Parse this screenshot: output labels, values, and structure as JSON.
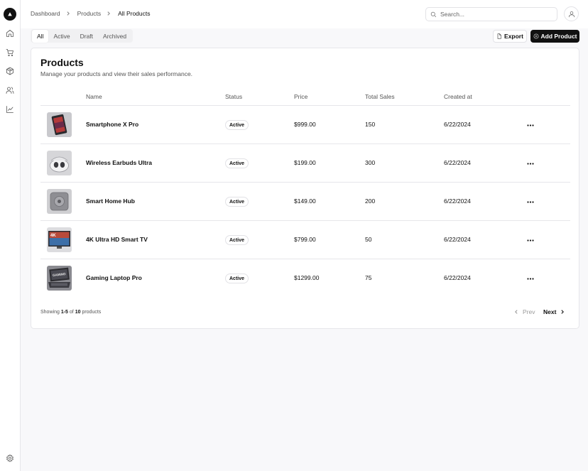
{
  "sidebar": {
    "items": [
      {
        "icon": "home-icon",
        "label": "Dashboard"
      },
      {
        "icon": "cart-icon",
        "label": "Orders"
      },
      {
        "icon": "package-icon",
        "label": "Products"
      },
      {
        "icon": "users-icon",
        "label": "Customers"
      },
      {
        "icon": "chart-icon",
        "label": "Analytics"
      }
    ],
    "settings_icon": "gear-icon"
  },
  "breadcrumb": {
    "items": [
      "Dashboard",
      "Products",
      "All Products"
    ]
  },
  "search": {
    "placeholder": "Search...",
    "value": ""
  },
  "tabs": [
    {
      "label": "All",
      "active": true
    },
    {
      "label": "Active",
      "active": false
    },
    {
      "label": "Draft",
      "active": false
    },
    {
      "label": "Archived",
      "active": false
    }
  ],
  "toolbar": {
    "export_label": "Export",
    "add_label": "Add Product"
  },
  "card": {
    "title": "Products",
    "subtitle": "Manage your products and view their sales performance."
  },
  "table": {
    "columns": [
      "Name",
      "Status",
      "Price",
      "Total Sales",
      "Created at"
    ],
    "rows": [
      {
        "name": "Smartphone X Pro",
        "status": "Active",
        "price": "$999.00",
        "sales": "150",
        "created": "6/22/2024",
        "thumb": "smartphone"
      },
      {
        "name": "Wireless Earbuds Ultra",
        "status": "Active",
        "price": "$199.00",
        "sales": "300",
        "created": "6/22/2024",
        "thumb": "earbuds"
      },
      {
        "name": "Smart Home Hub",
        "status": "Active",
        "price": "$149.00",
        "sales": "200",
        "created": "6/22/2024",
        "thumb": "hub"
      },
      {
        "name": "4K Ultra HD Smart TV",
        "status": "Active",
        "price": "$799.00",
        "sales": "50",
        "created": "6/22/2024",
        "thumb": "tv"
      },
      {
        "name": "Gaming Laptop Pro",
        "status": "Active",
        "price": "$1299.00",
        "sales": "75",
        "created": "6/22/2024",
        "thumb": "laptop"
      }
    ]
  },
  "footer": {
    "showing_label": "Showing",
    "range": "1-5",
    "of_label": "of",
    "total": "10",
    "unit_label": "products",
    "prev_label": "Prev",
    "next_label": "Next"
  },
  "thumb_text": {
    "tv": "4K",
    "laptop": "GAMING"
  }
}
